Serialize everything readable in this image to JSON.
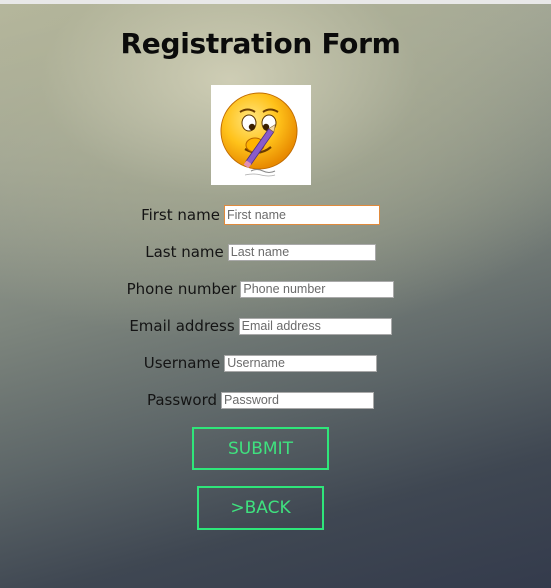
{
  "page": {
    "title": "Registration Form"
  },
  "form": {
    "fields": [
      {
        "label": "First name",
        "placeholder": "First name",
        "value": ""
      },
      {
        "label": "Last name",
        "placeholder": "Last name",
        "value": ""
      },
      {
        "label": "Phone number",
        "placeholder": "Phone number",
        "value": ""
      },
      {
        "label": "Email address",
        "placeholder": "Email address",
        "value": ""
      },
      {
        "label": "Username",
        "placeholder": "Username",
        "value": ""
      },
      {
        "label": "Password",
        "placeholder": "Password",
        "value": ""
      }
    ],
    "submit_label": "SUBMIT",
    "back_label": ">BACK"
  },
  "icons": {
    "avatar": "writing-emoji-icon"
  },
  "colors": {
    "button_accent": "#2fe67a",
    "focus_border": "#e08a3c",
    "title_text": "#0b0b0b"
  }
}
